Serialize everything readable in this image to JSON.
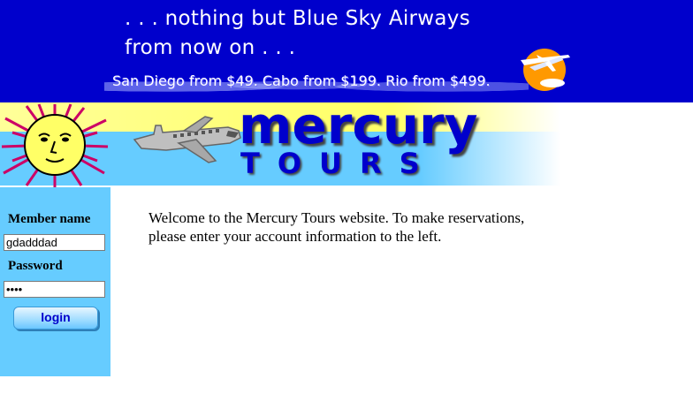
{
  "banner": {
    "line1": ". . . nothing but Blue Sky Airways",
    "line2": "from now on . . .",
    "promo": "San Diego from $49. Cabo from $199. Rio from $499.",
    "logo_icon": "airline-logo-icon"
  },
  "header": {
    "brand_top": "mercury",
    "brand_bottom": "TOURS",
    "sun_icon": "sun-icon",
    "plane_icon": "plane-icon"
  },
  "login": {
    "member_label": "Member name",
    "member_value": "gdadddad",
    "password_label": "Password",
    "password_value": "••••",
    "login_label": "login"
  },
  "main": {
    "welcome": "Welcome to the Mercury Tours website. To make reservations, please enter your account information to the left."
  },
  "colors": {
    "banner_blue": "#0000cc",
    "sidebar_blue": "#66ccff",
    "band_yellow": "#ffff66",
    "brand_blue": "#0000cc"
  }
}
